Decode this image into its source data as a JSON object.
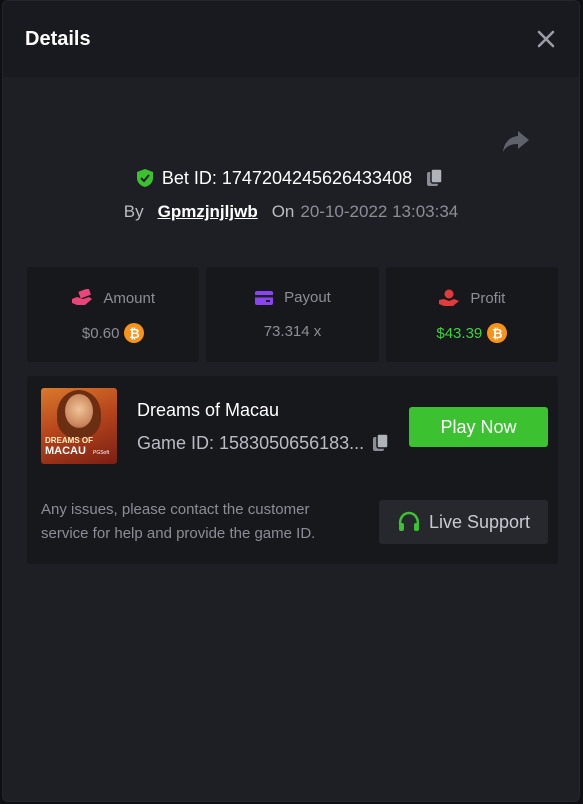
{
  "header": {
    "title": "Details"
  },
  "bet": {
    "id_label": "Bet ID: 1747204245626433408",
    "by_label": "By",
    "username": "Gpmzjnjljwb",
    "on_label": "On",
    "datetime": "20-10-2022 13:03:34"
  },
  "stats": {
    "amount": {
      "label": "Amount",
      "value": "$0.60",
      "icon": "money-hand-icon",
      "color": "#e8457a"
    },
    "payout": {
      "label": "Payout",
      "value": "73.314 x",
      "icon": "card-icon",
      "color": "#8a44f0"
    },
    "profit": {
      "label": "Profit",
      "value": "$43.39",
      "icon": "hand-coin-icon",
      "color": "#e23b3b",
      "value_color": "#3ed23c"
    }
  },
  "currency_symbol": "₿",
  "game": {
    "name": "Dreams of Macau",
    "id_label": "Game ID: 1583050656183...",
    "thumb_line1": "DREAMS OF",
    "thumb_line2": "MACAU",
    "thumb_line3": "PGSoft",
    "play_label": "Play Now"
  },
  "support": {
    "message": "Any issues, please contact the customer service for help and provide the game ID.",
    "button_label": "Live Support"
  },
  "colors": {
    "accent_green": "#3cc231",
    "panel": "#17181c",
    "background": "#1d1f24"
  }
}
